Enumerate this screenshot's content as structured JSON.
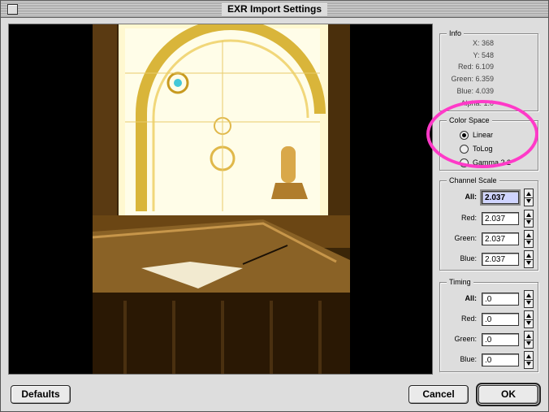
{
  "window": {
    "title": "EXR Import Settings"
  },
  "info": {
    "title": "Info",
    "x_label": "X:",
    "x": "368",
    "y_label": "Y:",
    "y": "548",
    "red_label": "Red:",
    "red": "6.109",
    "green_label": "Green:",
    "green": "6.359",
    "blue_label": "Blue:",
    "blue": "4.039",
    "alpha_label": "Alpha:",
    "alpha": "1.0"
  },
  "color_space": {
    "title": "Color Space",
    "options": [
      {
        "label": "Linear",
        "selected": true
      },
      {
        "label": "ToLog",
        "selected": false
      },
      {
        "label": "Gamma 2.2",
        "selected": false
      }
    ]
  },
  "channel_scale": {
    "title": "Channel Scale",
    "rows": [
      {
        "label": "All:",
        "value": "2.037"
      },
      {
        "label": "Red:",
        "value": "2.037"
      },
      {
        "label": "Green:",
        "value": "2.037"
      },
      {
        "label": "Blue:",
        "value": "2.037"
      }
    ]
  },
  "timing": {
    "title": "Timing",
    "rows": [
      {
        "label": "All:",
        "value": ".0"
      },
      {
        "label": "Red:",
        "value": ".0"
      },
      {
        "label": "Green:",
        "value": ".0"
      },
      {
        "label": "Blue:",
        "value": ".0"
      }
    ]
  },
  "buttons": {
    "defaults": "Defaults",
    "cancel": "Cancel",
    "ok": "OK"
  },
  "colors": {
    "highlight_ellipse": "#ff3ac8",
    "active_field": "#cfd4ff"
  }
}
